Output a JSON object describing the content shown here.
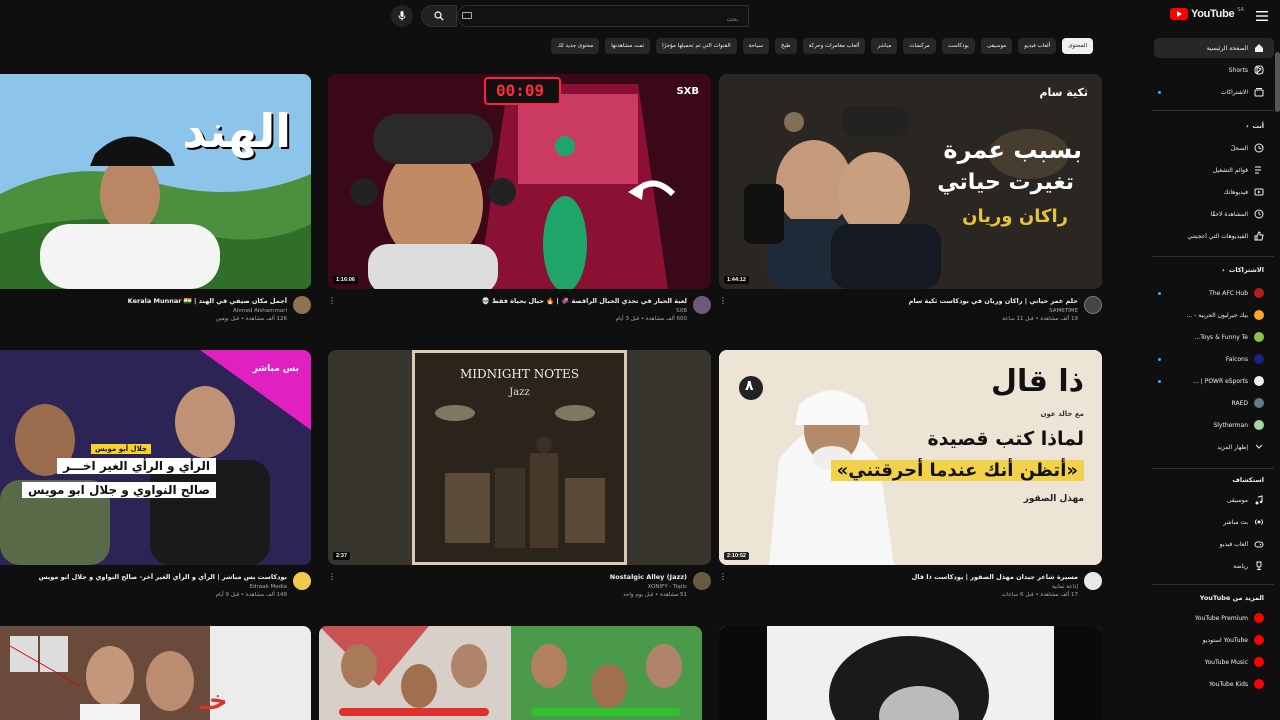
{
  "header": {
    "logo_text": "YouTube",
    "logo_region": "SA",
    "search_placeholder": "بحث"
  },
  "chips": [
    {
      "label": "المحتوى",
      "active": true
    },
    {
      "label": "ألعاب فيديو"
    },
    {
      "label": "موسيقى"
    },
    {
      "label": "بودكاست"
    },
    {
      "label": "مركسات"
    },
    {
      "label": "مباشر"
    },
    {
      "label": "ألعاب مغامرات وحركة"
    },
    {
      "label": "طبخ"
    },
    {
      "label": "سياحة"
    },
    {
      "label": "القنوات التي تم تحميلها مؤخرًا"
    },
    {
      "label": "تمت مشاهدتها"
    },
    {
      "label": "محتوى جديد لك"
    }
  ],
  "sidebar": {
    "main": [
      {
        "label": "الصفحة الرئيسية",
        "icon": "home-icon"
      },
      {
        "label": "Shorts",
        "icon": "shorts-icon"
      },
      {
        "label": "الاشتراكات",
        "icon": "subscriptions-icon"
      }
    ],
    "you_heading": "أنت",
    "you": [
      {
        "label": "السجلّ",
        "icon": "history-icon"
      },
      {
        "label": "قوائم التشغيل",
        "icon": "playlist-icon"
      },
      {
        "label": "فيديوهاتك",
        "icon": "your-videos-icon"
      },
      {
        "label": "المشاهدة لاحقًا",
        "icon": "watch-later-icon"
      },
      {
        "label": "الفيديوهات التي أعجبتني",
        "icon": "like-icon"
      }
    ],
    "subs_heading": "الاشتراكات",
    "subs": [
      {
        "label": "The AFC Hub",
        "color": "#b71c1c"
      },
      {
        "label": "بيك جيرليون الحربية - …",
        "color": "#f9a825"
      },
      {
        "label": "Toys & Funny Te...",
        "color": "#8bc34a"
      },
      {
        "label": "Falcons",
        "color": "#1a237e"
      },
      {
        "label": "POWR eSports | …",
        "color": "#eeeeee"
      },
      {
        "label": "RAED",
        "color": "#607d8b"
      },
      {
        "label": "Slytherman",
        "color": "#a5d6a7"
      }
    ],
    "show_more": "إظهار المزيد",
    "explore_heading": "استكشاف",
    "explore": [
      {
        "label": "موسيقى",
        "icon": "music-icon"
      },
      {
        "label": "بث مباشر",
        "icon": "live-icon"
      },
      {
        "label": "ألعاب فيديو",
        "icon": "gaming-icon"
      },
      {
        "label": "رياضة",
        "icon": "sports-icon"
      }
    ],
    "more_heading": "المزيد من YouTube",
    "more": [
      {
        "label": "YouTube Premium"
      },
      {
        "label": "YouTube استوديو"
      },
      {
        "label": "YouTube Music"
      },
      {
        "label": "YouTube Kids"
      }
    ]
  },
  "videos": [
    {
      "title": "حلم عمر حياتي | راكان وريان في بودكاست ثكية سام",
      "channel": "SAM6TIME",
      "stats": "19 ألف مشاهدة • قبل 11 ساعة",
      "duration": "1:44:12",
      "thumb_title": "بسبب عمرة",
      "thumb_sub": "تغيرت حياتي",
      "thumb_name": "راكان وريان",
      "thumb_logo": "ثكية سام"
    },
    {
      "title": "لعبة الحبار في تحدي الحبال الراقصة 🦑 | 🔥 حبال بحياة فقط 💀",
      "channel": "SXB",
      "stats": "600 ألف مشاهدة • قبل 3 أيام",
      "duration": "1:16:06",
      "timer": "00:09",
      "brand": "SXB"
    },
    {
      "title": "أجمل مكان صيفي في الهند | Kerala Munnar 🇮🇳",
      "channel": "Ahmed Alshammari",
      "stats": "126 ألف مشاهدة • قبل يومين",
      "duration": "",
      "thumb_title": "الهند"
    },
    {
      "title": "مسيرة شاعر جيدان مهذل الصقور | بودكاست ذا قال",
      "channel": "إذاعة ثمانية",
      "stats": "17 ألف مشاهدة • قبل 6 ساعات",
      "duration": "2:10:52",
      "thumb_title": "ذا قال",
      "thumb_with": "مع خالد عون",
      "thumb_q1": "لماذا كتب قصيدة",
      "thumb_q2": "«أتظن أنك عندما أحرقتني»",
      "thumb_name": "مهذل الصقور"
    },
    {
      "title": "Nostalgic Alley (Jazz)",
      "channel": "XONIFY - Topic",
      "stats": "51 مشاهدة • قبل يوم واحد",
      "duration": "2:37",
      "album_title": "MIDNIGHT NOTES",
      "album_sub": "Jazz"
    },
    {
      "title": "بودكاست بس مباشر | الرأي و الرأي الغير آخر- صالح النواوي و جلال ابو مويس",
      "channel": "Edraak Media",
      "stats": "149 ألف مشاهدة • قبل 9 أيام",
      "duration": "",
      "thumb_tag": "جلال أبو مويس",
      "thumb_l1": "الرأي و الرأي الغير اخـــر",
      "thumb_l2": "صالح النواوي و جلال ابو مويس",
      "thumb_logo": "بس مباشر"
    }
  ],
  "colors": {
    "bg": "#0f0f0f",
    "chip": "#272727",
    "accent": "#ff0000",
    "text_secondary": "#aaaaaa"
  }
}
